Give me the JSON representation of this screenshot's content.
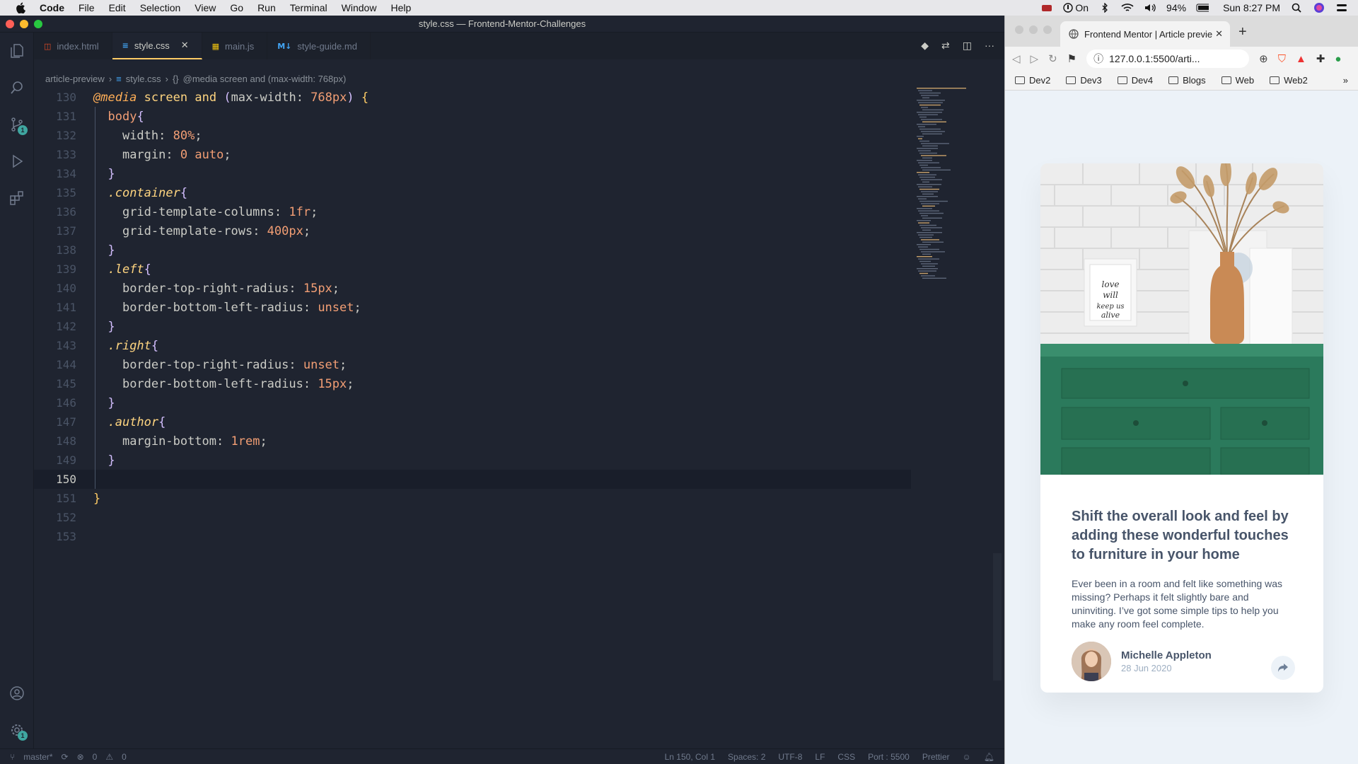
{
  "menubar": {
    "app": "Code",
    "items": [
      "File",
      "Edit",
      "Selection",
      "View",
      "Go",
      "Run",
      "Terminal",
      "Window",
      "Help"
    ],
    "focus_label": "On",
    "battery": "94%",
    "clock": "Sun 8:27 PM"
  },
  "vscode": {
    "window_title": "style.css — Frontend-Mentor-Challenges",
    "tabs": [
      {
        "label": "index.html",
        "icon": "html-file-icon",
        "icon_glyph": "◫",
        "color": "#e34c26"
      },
      {
        "label": "style.css",
        "icon": "css-file-icon",
        "icon_glyph": "≡",
        "color": "#42a5f5",
        "active": true
      },
      {
        "label": "main.js",
        "icon": "js-file-icon",
        "icon_glyph": "▦",
        "color": "#f1c40f"
      },
      {
        "label": "style-guide.md",
        "icon": "markdown-file-icon",
        "icon_glyph": "M↓",
        "color": "#42a5f5"
      }
    ],
    "breadcrumb": {
      "folder": "article-preview",
      "file": "style.css",
      "symbol": "@media screen and (max-width: 768px)"
    },
    "scm_badge": "1",
    "settings_badge": "1",
    "status": {
      "branch": "master*",
      "errors": "0",
      "warnings": "0",
      "position": "Ln 150, Col 1",
      "spaces": "Spaces: 2",
      "encoding": "UTF-8",
      "eol": "LF",
      "language": "CSS",
      "port": "Port : 5500",
      "formatter": "Prettier"
    },
    "lines": [
      {
        "n": "130",
        "t": [
          [
            "k-at",
            "@media"
          ],
          [
            "k-pun",
            " "
          ],
          [
            "k-kw",
            "screen"
          ],
          [
            "k-pun",
            " "
          ],
          [
            "k-kw",
            "and"
          ],
          [
            "k-pun",
            " "
          ],
          [
            "k-br2",
            "("
          ],
          [
            "k-prop",
            "max-width"
          ],
          [
            "k-pun",
            ": "
          ],
          [
            "k-num",
            "768px"
          ],
          [
            "k-br2",
            ")"
          ],
          [
            "k-pun",
            " "
          ],
          [
            "k-br1",
            "{"
          ]
        ]
      },
      {
        "n": "131",
        "t": [
          [
            "k-pun",
            "  "
          ],
          [
            "k-tag",
            "body"
          ],
          [
            "k-br2",
            "{"
          ]
        ]
      },
      {
        "n": "132",
        "t": [
          [
            "k-pun",
            "    "
          ],
          [
            "k-prop",
            "width"
          ],
          [
            "k-pun",
            ": "
          ],
          [
            "k-num",
            "80%"
          ],
          [
            "k-pun",
            ";"
          ]
        ]
      },
      {
        "n": "133",
        "t": [
          [
            "k-pun",
            "    "
          ],
          [
            "k-prop",
            "margin"
          ],
          [
            "k-pun",
            ": "
          ],
          [
            "k-num",
            "0"
          ],
          [
            "k-pun",
            " "
          ],
          [
            "k-val",
            "auto"
          ],
          [
            "k-pun",
            ";"
          ]
        ]
      },
      {
        "n": "134",
        "t": [
          [
            "k-pun",
            "  "
          ],
          [
            "k-br2",
            "}"
          ]
        ]
      },
      {
        "n": "135",
        "t": [
          [
            "k-pun",
            "  "
          ],
          [
            "k-sel",
            ".container"
          ],
          [
            "k-br2",
            "{"
          ]
        ]
      },
      {
        "n": "136",
        "t": [
          [
            "k-pun",
            "    "
          ],
          [
            "k-prop",
            "grid-template-columns"
          ],
          [
            "k-pun",
            ": "
          ],
          [
            "k-num",
            "1fr"
          ],
          [
            "k-pun",
            ";"
          ]
        ]
      },
      {
        "n": "137",
        "t": [
          [
            "k-pun",
            "    "
          ],
          [
            "k-prop",
            "grid-template-rows"
          ],
          [
            "k-pun",
            ": "
          ],
          [
            "k-num",
            "400px"
          ],
          [
            "k-pun",
            ";"
          ]
        ]
      },
      {
        "n": "138",
        "t": [
          [
            "k-pun",
            "  "
          ],
          [
            "k-br2",
            "}"
          ]
        ]
      },
      {
        "n": "139",
        "t": [
          [
            "k-pun",
            "  "
          ],
          [
            "k-sel",
            ".left"
          ],
          [
            "k-br2",
            "{"
          ]
        ]
      },
      {
        "n": "140",
        "t": [
          [
            "k-pun",
            "    "
          ],
          [
            "k-prop",
            "border-top-right-radius"
          ],
          [
            "k-pun",
            ": "
          ],
          [
            "k-num",
            "15px"
          ],
          [
            "k-pun",
            ";"
          ]
        ]
      },
      {
        "n": "141",
        "t": [
          [
            "k-pun",
            "    "
          ],
          [
            "k-prop",
            "border-bottom-left-radius"
          ],
          [
            "k-pun",
            ": "
          ],
          [
            "k-val",
            "unset"
          ],
          [
            "k-pun",
            ";"
          ]
        ]
      },
      {
        "n": "142",
        "t": [
          [
            "k-pun",
            "  "
          ],
          [
            "k-br2",
            "}"
          ]
        ]
      },
      {
        "n": "143",
        "t": [
          [
            "k-pun",
            "  "
          ],
          [
            "k-sel",
            ".right"
          ],
          [
            "k-br2",
            "{"
          ]
        ]
      },
      {
        "n": "144",
        "t": [
          [
            "k-pun",
            "    "
          ],
          [
            "k-prop",
            "border-top-right-radius"
          ],
          [
            "k-pun",
            ": "
          ],
          [
            "k-val",
            "unset"
          ],
          [
            "k-pun",
            ";"
          ]
        ]
      },
      {
        "n": "145",
        "t": [
          [
            "k-pun",
            "    "
          ],
          [
            "k-prop",
            "border-bottom-left-radius"
          ],
          [
            "k-pun",
            ": "
          ],
          [
            "k-num",
            "15px"
          ],
          [
            "k-pun",
            ";"
          ]
        ]
      },
      {
        "n": "146",
        "t": [
          [
            "k-pun",
            "  "
          ],
          [
            "k-br2",
            "}"
          ]
        ]
      },
      {
        "n": "147",
        "t": [
          [
            "k-pun",
            "  "
          ],
          [
            "k-sel",
            ".author"
          ],
          [
            "k-br2",
            "{"
          ]
        ]
      },
      {
        "n": "148",
        "t": [
          [
            "k-pun",
            "    "
          ],
          [
            "k-prop",
            "margin-bottom"
          ],
          [
            "k-pun",
            ": "
          ],
          [
            "k-num",
            "1rem"
          ],
          [
            "k-pun",
            ";"
          ]
        ]
      },
      {
        "n": "149",
        "t": [
          [
            "k-pun",
            "  "
          ],
          [
            "k-br2",
            "}"
          ]
        ]
      },
      {
        "n": "150",
        "t": [],
        "current": true
      },
      {
        "n": "151",
        "t": [
          [
            "k-br1",
            "}"
          ]
        ]
      },
      {
        "n": "152",
        "t": []
      },
      {
        "n": "153",
        "t": []
      }
    ]
  },
  "browser": {
    "tab_title": "Frontend Mentor | Article previe",
    "url": "127.0.0.1:5500/arti...",
    "bookmarks": [
      "Dev2",
      "Dev3",
      "Dev4",
      "Blogs",
      "Web",
      "Web2"
    ],
    "article": {
      "title": "Shift the overall look and feel by adding these wonderful touches to furniture in your home",
      "body": "Ever been in a room and felt like something was missing? Perhaps it felt slightly bare and uninviting. I’ve got some simple tips to help you make any room feel complete.",
      "author": "Michelle Appleton",
      "date": "28 Jun 2020"
    },
    "colors": {
      "page_bg": "#ecf2f8",
      "text": "#48556a",
      "muted": "#9eafc2",
      "drawer": "#2b7a5c"
    }
  }
}
